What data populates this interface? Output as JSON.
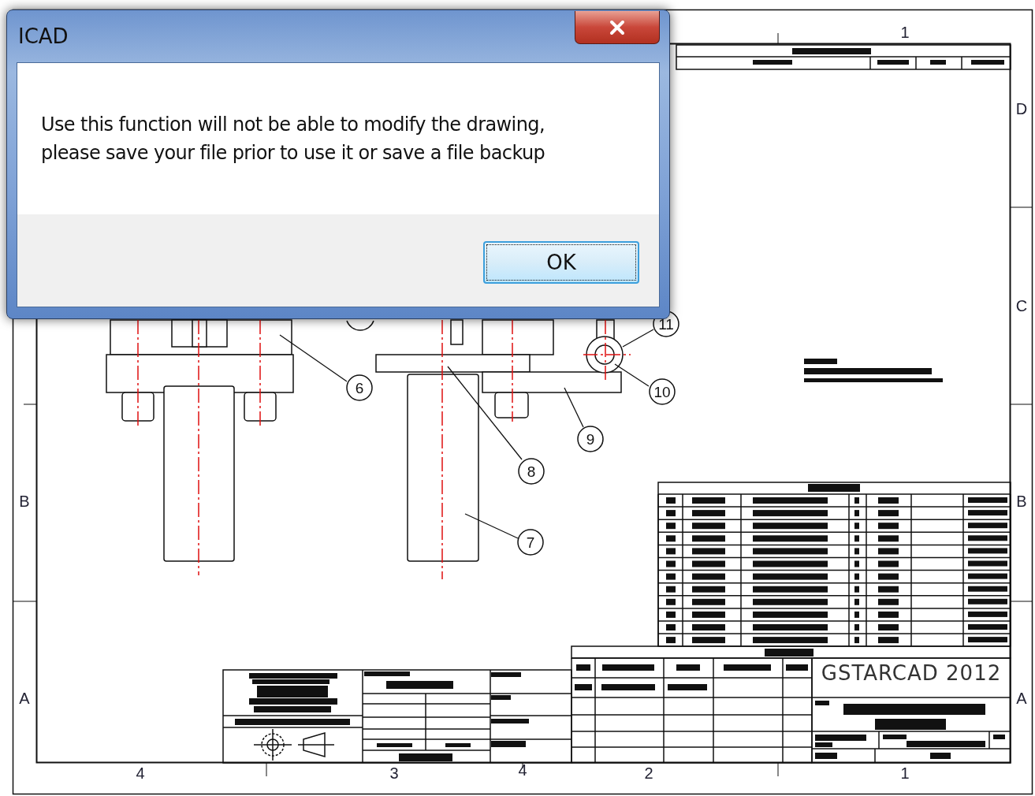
{
  "dialog": {
    "title": "ICAD",
    "message": "Use this function will not be able to modify the drawing,\nplease save your file prior to use it or save a file backup",
    "ok_button": {
      "label": "OK",
      "focused": true
    }
  },
  "drawing": {
    "top_zone_labels": [
      "1"
    ],
    "bottom_zone_labels": [
      "4",
      "3",
      "4",
      "2",
      "1"
    ],
    "right_zone_labels": [
      "D",
      "C",
      "B",
      "A"
    ],
    "left_zone_labels": [
      "B",
      "A"
    ],
    "balloons": [
      "6",
      "7",
      "8",
      "9",
      "10",
      "11"
    ],
    "title_block": {
      "company": "GSTARCAD 2012"
    }
  }
}
